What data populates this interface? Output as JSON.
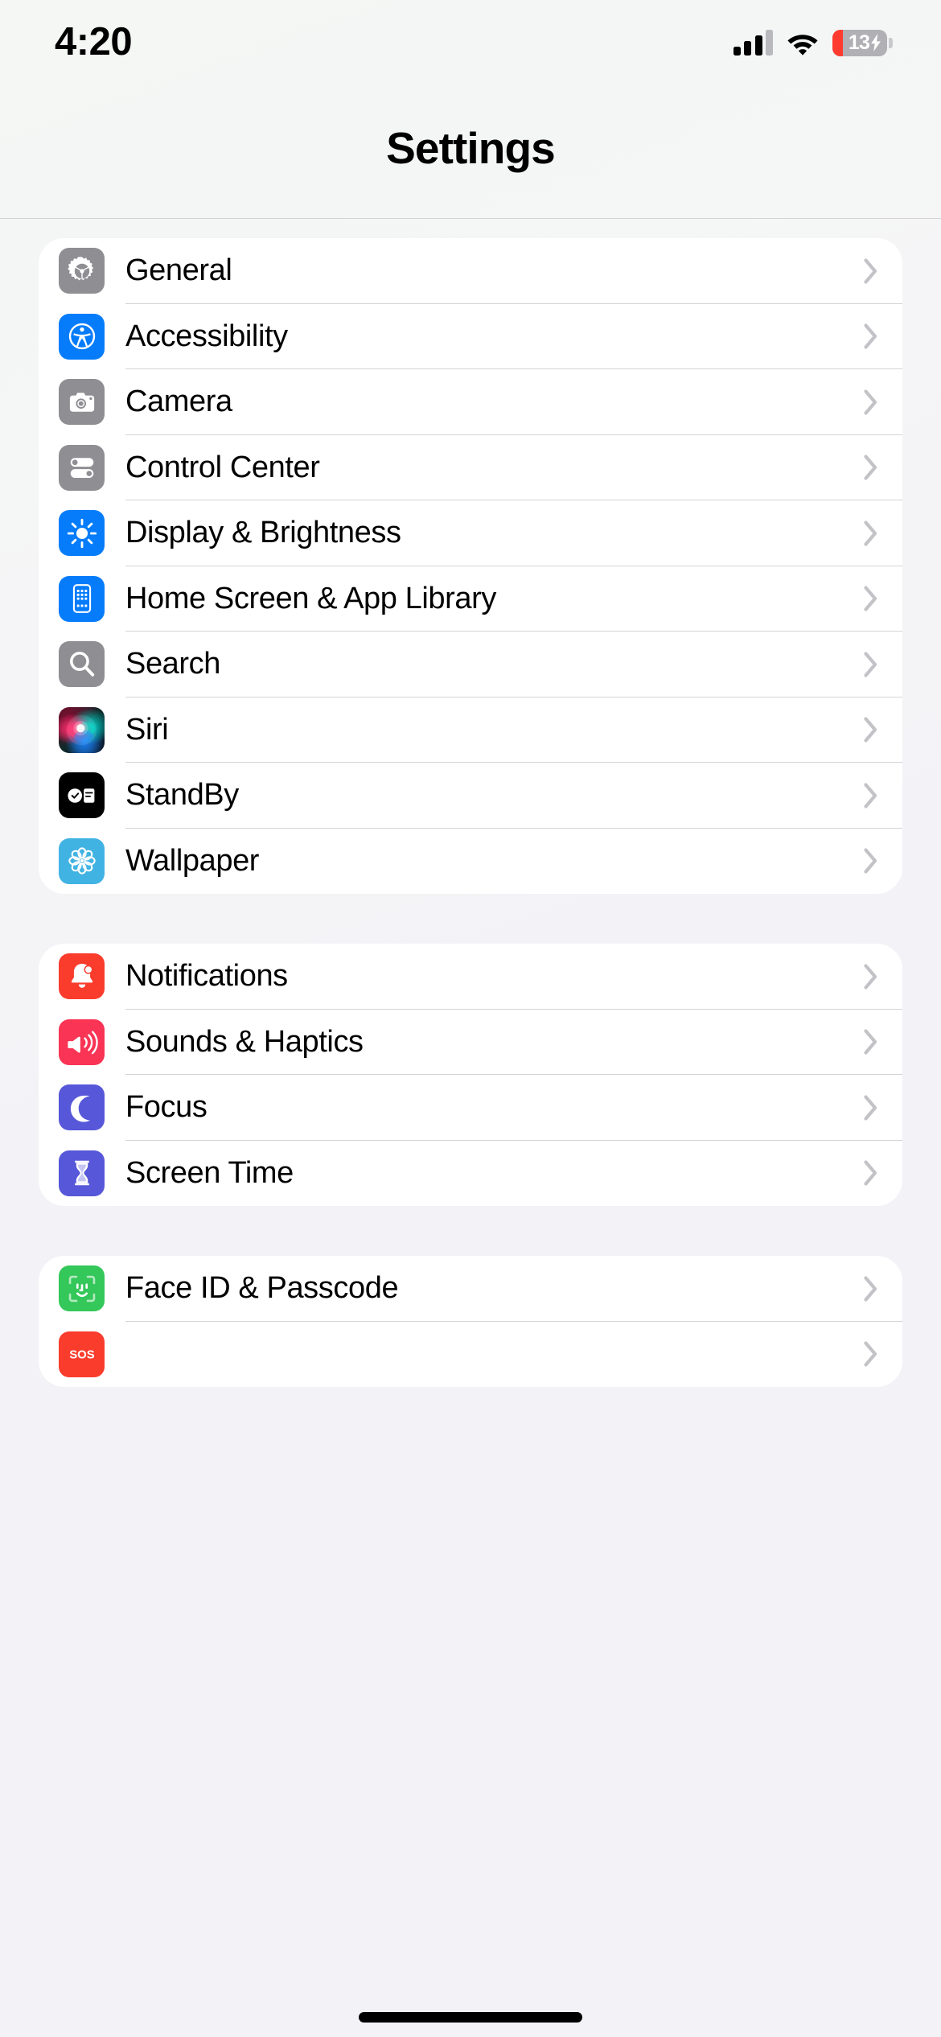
{
  "status_bar": {
    "time": "4:20",
    "signal_icon": "cellular-signal-icon",
    "signal_bars_filled": 3,
    "signal_bars_total": 4,
    "wifi_icon": "wifi-icon",
    "battery": {
      "icon": "battery-charging-icon",
      "percent_label": "13",
      "percent_value": 13,
      "charging": true,
      "fill_color": "#ff3b30",
      "body_color": "#b0b0b5"
    }
  },
  "header": {
    "title": "Settings"
  },
  "colors": {
    "page_background": "#f2f2f7",
    "card_background": "#ffffff",
    "separator": "#d4d4d8",
    "chevron": "#c3c3c7",
    "label_text": "#000000"
  },
  "groups": [
    {
      "name": "system-group",
      "rows": [
        {
          "label": "General",
          "icon": "gear-icon",
          "tile": "bg-gray",
          "chevron": "chevron-right-icon"
        },
        {
          "label": "Accessibility",
          "icon": "accessibility-person-icon",
          "tile": "bg-blue",
          "chevron": "chevron-right-icon"
        },
        {
          "label": "Camera",
          "icon": "camera-icon",
          "tile": "bg-gray",
          "chevron": "chevron-right-icon"
        },
        {
          "label": "Control Center",
          "icon": "toggles-icon",
          "tile": "bg-gray",
          "chevron": "chevron-right-icon"
        },
        {
          "label": "Display & Brightness",
          "icon": "sun-brightness-icon",
          "tile": "bg-blue",
          "chevron": "chevron-right-icon"
        },
        {
          "label": "Home Screen & App Library",
          "icon": "app-grid-phone-icon",
          "tile": "bg-blue",
          "chevron": "chevron-right-icon"
        },
        {
          "label": "Search",
          "icon": "magnifier-icon",
          "tile": "bg-gray",
          "chevron": "chevron-right-icon"
        },
        {
          "label": "Siri",
          "icon": "siri-orb-icon",
          "tile": "bg-siri",
          "chevron": "chevron-right-icon"
        },
        {
          "label": "StandBy",
          "icon": "standby-clock-widget-icon",
          "tile": "bg-black",
          "chevron": "chevron-right-icon"
        },
        {
          "label": "Wallpaper",
          "icon": "flower-pattern-icon",
          "tile": "bg-cyan",
          "chevron": "chevron-right-icon"
        }
      ]
    },
    {
      "name": "alerts-group",
      "rows": [
        {
          "label": "Notifications",
          "icon": "bell-badge-icon",
          "tile": "bg-red",
          "chevron": "chevron-right-icon"
        },
        {
          "label": "Sounds & Haptics",
          "icon": "speaker-waves-icon",
          "tile": "bg-pink",
          "chevron": "chevron-right-icon"
        },
        {
          "label": "Focus",
          "icon": "crescent-moon-icon",
          "tile": "bg-indigo",
          "chevron": "chevron-right-icon"
        },
        {
          "label": "Screen Time",
          "icon": "hourglass-icon",
          "tile": "bg-indigo",
          "chevron": "chevron-right-icon"
        }
      ]
    },
    {
      "name": "security-group",
      "rows": [
        {
          "label": "Face ID & Passcode",
          "icon": "face-id-icon",
          "tile": "bg-green",
          "chevron": "chevron-right-icon"
        },
        {
          "label": "",
          "icon": "emergency-sos-icon",
          "tile": "bg-red",
          "chevron": "chevron-right-icon"
        }
      ]
    }
  ],
  "home_indicator": {
    "icon": "home-indicator-bar"
  }
}
